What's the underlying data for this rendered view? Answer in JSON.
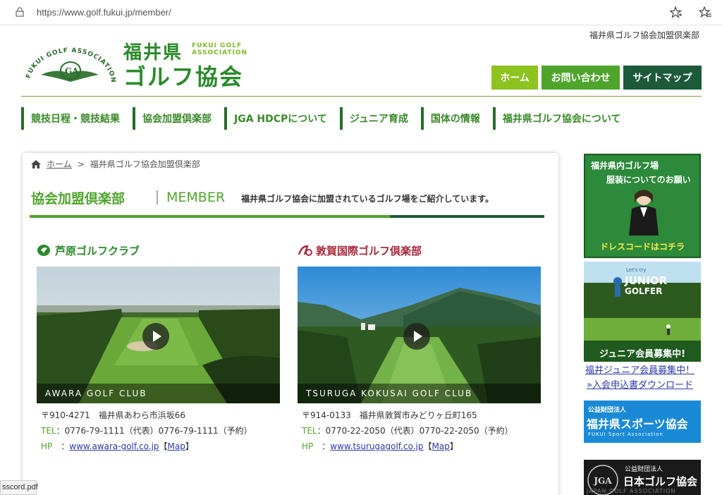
{
  "browser": {
    "url": "https://www.golf.fukui.jp/member/"
  },
  "header": {
    "top_note": "福井県ゴルフ協会加盟倶楽部",
    "logo_jp_line1": "福井県",
    "logo_en_line1": "FUKUI GOLF",
    "logo_en_line2": "ASSOCIATION",
    "logo_jp_line2": "ゴルフ協会",
    "logo_ring_text": "FUKUI GOLF ASSOCIATION",
    "buttons": {
      "home": "ホーム",
      "contact": "お問い合わせ",
      "sitemap": "サイトマップ"
    }
  },
  "nav": {
    "items": [
      "競技日程・競技結果",
      "協会加盟倶楽部",
      "JGA HDCPについて",
      "ジュニア育成",
      "国体の情報",
      "福井県ゴルフ協会について"
    ]
  },
  "breadcrumb": {
    "home": "ホーム",
    "separator": ">",
    "current": "福井県ゴルフ協会加盟倶楽部"
  },
  "section": {
    "title": "協会加盟倶楽部",
    "title_en": "MEMBER",
    "description": "福井県ゴルフ協会に加盟されているゴルフ場をご紹介しています。"
  },
  "clubs": [
    {
      "name": "芦原ゴルフクラブ",
      "caption": "AWARA GOLF CLUB",
      "address": "〒910-4271　福井県あわら市浜坂66",
      "tel_label": "TEL",
      "tel": "：0776-79-1111（代表）0776-79-1111（予約）",
      "hp_label": "HP",
      "hp_sep": "　：",
      "hp_url": "www.awara-golf.co.jp",
      "map_open": "【",
      "map": "Map",
      "map_close": "】",
      "name_color": "#2a8a2a"
    },
    {
      "name": "敦賀国際ゴルフ倶楽部",
      "caption": "TSURUGA KOKUSAI GOLF CLUB",
      "address": "〒914-0133　福井県敦賀市みどりヶ丘町165",
      "tel_label": "TEL",
      "tel": "：0770-22-2050（代表）0770-22-2050（予約）",
      "hp_label": "HP",
      "hp_sep": "　：",
      "hp_url": "www.tsurugagolf.co.jp",
      "map_open": "【",
      "map": "Map",
      "map_close": "】",
      "name_color": "#a8283a"
    }
  ],
  "sidebar": {
    "dress_banner": {
      "line1": "福井県内ゴルフ場",
      "line2": "服装についてのお願い",
      "cta": "ドレスコードはコチラ"
    },
    "junior_banner": {
      "small": "Let's try",
      "title1": "JUNIOR",
      "title2": "GOLFER",
      "cta": "ジュニア会員募集中!"
    },
    "junior_link1": "福井ジュニア会員募集中！",
    "junior_link2": "»入会申込書ダウンロード",
    "sports_banner": {
      "small": "公益財団法人",
      "title": "福井県スポーツ協会",
      "en": "FUKUI Sport Association"
    },
    "jga_banner": {
      "small": "公益財団法人",
      "title": "日本ゴルフ協会",
      "logo": "JGA",
      "en": "JAPAN GOLF ASSOCIATION"
    }
  },
  "status": {
    "download": "sscord.pdf"
  }
}
